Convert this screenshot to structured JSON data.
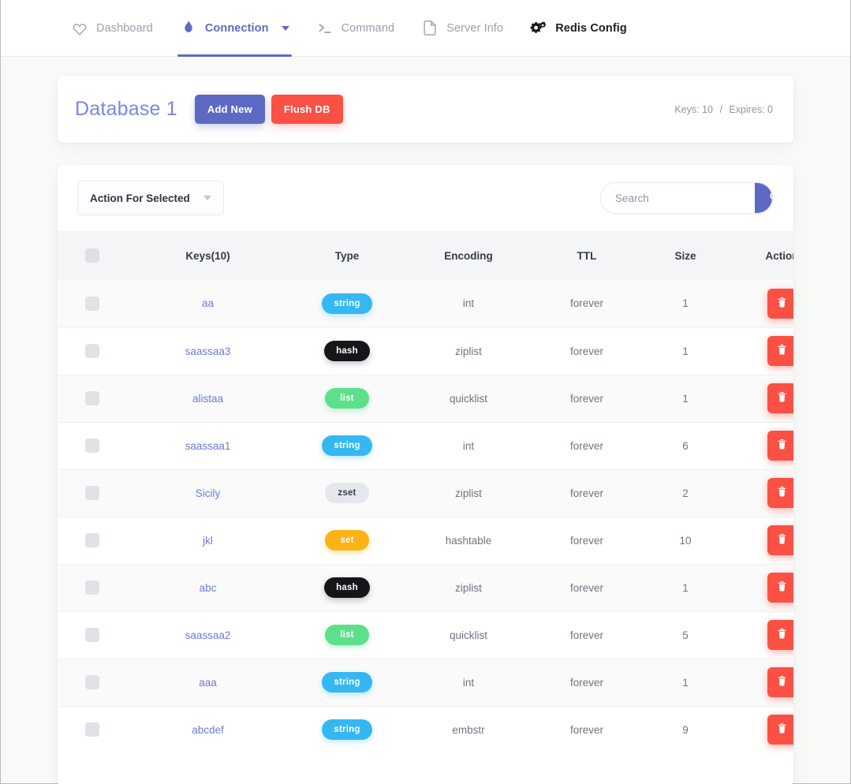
{
  "nav": {
    "items": [
      {
        "label": "Dashboard",
        "icon": "heart-icon",
        "state": "default"
      },
      {
        "label": "Connection",
        "icon": "flame-icon",
        "state": "active",
        "caret": true
      },
      {
        "label": "Command",
        "icon": "terminal-icon",
        "state": "default"
      },
      {
        "label": "Server Info",
        "icon": "document-icon",
        "state": "default"
      },
      {
        "label": "Redis Config",
        "icon": "gears-icon",
        "state": "dark"
      }
    ]
  },
  "database": {
    "title": "Database 1",
    "add_new_label": "Add New",
    "flush_db_label": "Flush DB",
    "keys_stat": "Keys: 10",
    "separator": "/",
    "expires_stat": "Expires: 0"
  },
  "toolbar": {
    "action_select_label": "Action For Selected",
    "search_placeholder": "Search",
    "search_value": "",
    "search_icon": "search-icon"
  },
  "table": {
    "headers": {
      "check": "",
      "keys": "Keys(10)",
      "type": "Type",
      "encoding": "Encoding",
      "ttl": "TTL",
      "size": "Size",
      "action": "Action"
    },
    "rows": [
      {
        "key": "aa",
        "type": "string",
        "encoding": "int",
        "ttl": "forever",
        "size": "1"
      },
      {
        "key": "saassaa3",
        "type": "hash",
        "encoding": "ziplist",
        "ttl": "forever",
        "size": "1"
      },
      {
        "key": "alistaa",
        "type": "list",
        "encoding": "quicklist",
        "ttl": "forever",
        "size": "1"
      },
      {
        "key": "saassaa1",
        "type": "string",
        "encoding": "int",
        "ttl": "forever",
        "size": "6"
      },
      {
        "key": "Sicily",
        "type": "zset",
        "encoding": "ziplist",
        "ttl": "forever",
        "size": "2"
      },
      {
        "key": "jkl",
        "type": "set",
        "encoding": "hashtable",
        "ttl": "forever",
        "size": "10"
      },
      {
        "key": "abc",
        "type": "hash",
        "encoding": "ziplist",
        "ttl": "forever",
        "size": "1"
      },
      {
        "key": "saassaa2",
        "type": "list",
        "encoding": "quicklist",
        "ttl": "forever",
        "size": "5"
      },
      {
        "key": "aaa",
        "type": "string",
        "encoding": "int",
        "ttl": "forever",
        "size": "1"
      },
      {
        "key": "abcdef",
        "type": "string",
        "encoding": "embstr",
        "ttl": "forever",
        "size": "9"
      }
    ],
    "delete_icon": "trash-icon"
  },
  "colors": {
    "accent": "#5c6ac4",
    "danger": "#fb5044",
    "key_link": "#6c7ae0",
    "badge_string": "#35b8f2",
    "badge_hash": "#14161a",
    "badge_list": "#5de08a",
    "badge_zset": "#e4e7eb",
    "badge_set": "#fcb316"
  }
}
